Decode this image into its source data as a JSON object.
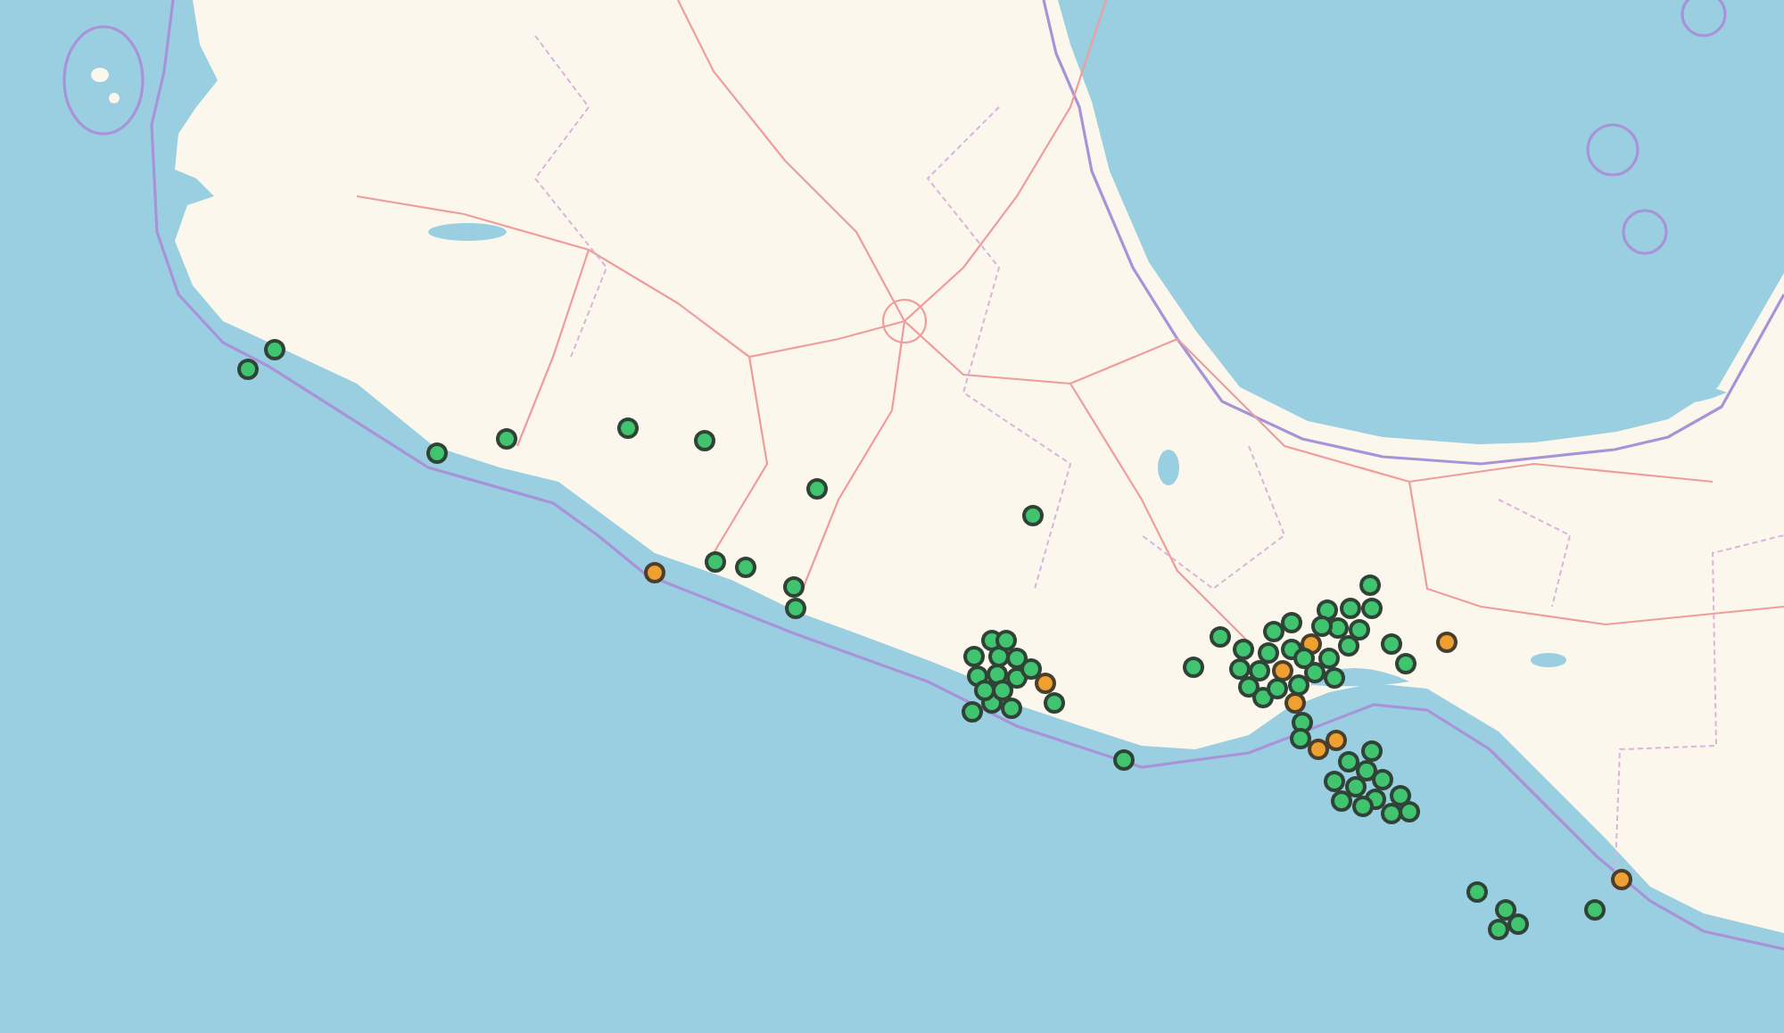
{
  "map": {
    "markers": [
      {
        "color": "#41c46f"
      },
      {
        "color": "#41c46f"
      },
      {
        "color": "#41c46f"
      },
      {
        "color": "#41c46f"
      },
      {
        "color": "#41c46f"
      },
      {
        "color": "#41c46f"
      },
      {
        "color": "#41c46f"
      },
      {
        "color": "#41c46f"
      },
      {
        "color": "#41c46f"
      },
      {
        "color": "#41c46f"
      },
      {
        "color": "#f0a030"
      },
      {
        "color": "#41c46f"
      },
      {
        "color": "#41c46f"
      },
      {
        "color": "#41c46f"
      },
      {
        "color": "#41c46f"
      },
      {
        "color": "#41c46f"
      },
      {
        "color": "#41c46f"
      },
      {
        "color": "#41c46f"
      },
      {
        "color": "#41c46f"
      },
      {
        "color": "#f0a030"
      },
      {
        "color": "#41c46f"
      },
      {
        "color": "#41c46f"
      },
      {
        "color": "#41c46f"
      },
      {
        "color": "#41c46f"
      },
      {
        "color": "#41c46f"
      },
      {
        "color": "#41c46f"
      },
      {
        "color": "#41c46f"
      },
      {
        "color": "#41c46f"
      },
      {
        "color": "#41c46f"
      },
      {
        "color": "#41c46f"
      },
      {
        "color": "#41c46f"
      },
      {
        "color": "#41c46f"
      },
      {
        "color": "#41c46f"
      },
      {
        "color": "#f0a030"
      },
      {
        "color": "#41c46f"
      },
      {
        "color": "#f0a030"
      },
      {
        "color": "#41c46f"
      },
      {
        "color": "#41c46f"
      },
      {
        "color": "#41c46f"
      },
      {
        "color": "#f0a030"
      },
      {
        "color": "#41c46f"
      },
      {
        "color": "#41c46f"
      },
      {
        "color": "#41c46f"
      },
      {
        "color": "#41c46f"
      },
      {
        "color": "#41c46f"
      },
      {
        "color": "#41c46f"
      },
      {
        "color": "#41c46f"
      },
      {
        "color": "#f0a030"
      },
      {
        "color": "#41c46f"
      },
      {
        "color": "#f0a030"
      },
      {
        "color": "#f0a030"
      },
      {
        "color": "#41c46f"
      },
      {
        "color": "#41c46f"
      },
      {
        "color": "#41c46f"
      },
      {
        "color": "#41c46f"
      },
      {
        "color": "#41c46f"
      },
      {
        "color": "#41c46f"
      },
      {
        "color": "#41c46f"
      },
      {
        "color": "#41c46f"
      },
      {
        "color": "#f0a030"
      },
      {
        "color": "#41c46f"
      },
      {
        "color": "#41c46f"
      },
      {
        "color": "#41c46f"
      },
      {
        "color": "#41c46f"
      },
      {
        "color": "#41c46f"
      },
      {
        "color": "#41c46f"
      },
      {
        "color": "#41c46f"
      },
      {
        "color": "#41c46f"
      },
      {
        "color": "#41c46f"
      },
      {
        "color": "#41c46f"
      },
      {
        "color": "#41c46f"
      },
      {
        "color": "#41c46f"
      },
      {
        "color": "#41c46f"
      },
      {
        "color": "#41c46f"
      },
      {
        "color": "#41c46f"
      },
      {
        "color": "#41c46f"
      },
      {
        "color": "#41c46f"
      },
      {
        "color": "#41c46f"
      },
      {
        "color": "#41c46f"
      },
      {
        "color": "#41c46f"
      },
      {
        "color": "#41c46f"
      },
      {
        "color": "#41c46f"
      },
      {
        "color": "#41c46f"
      }
    ]
  }
}
